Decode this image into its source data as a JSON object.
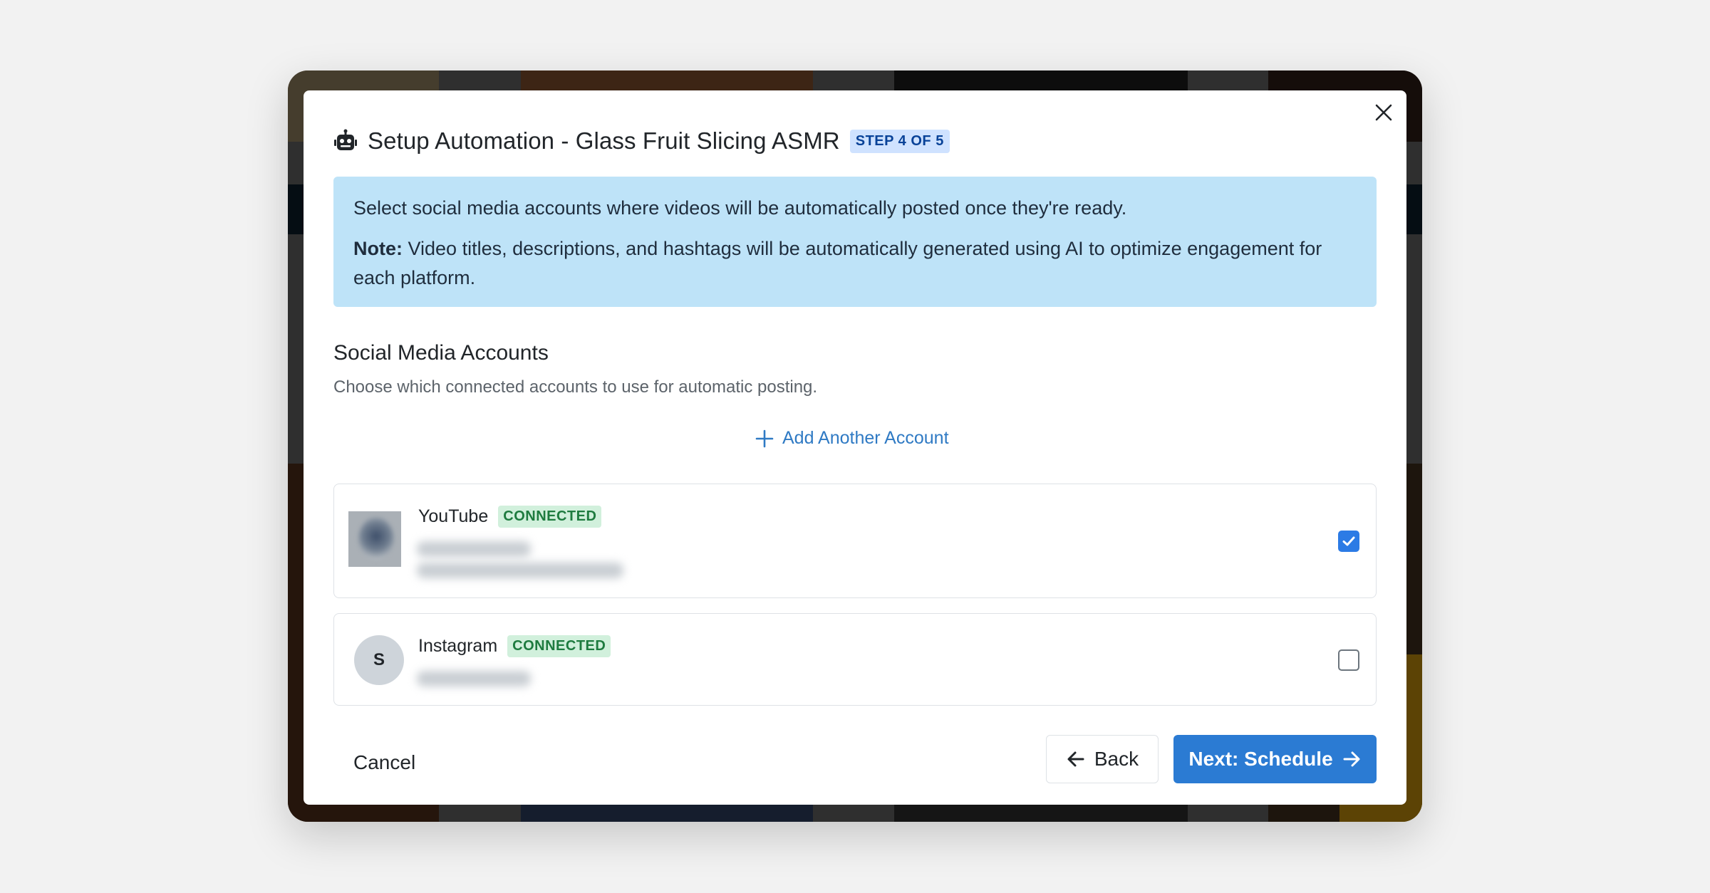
{
  "modal": {
    "title": "Setup Automation - Glass Fruit Slicing ASMR",
    "step_badge": "STEP 4 OF 5",
    "icons": {
      "title": "robot-icon",
      "close": "close-icon"
    }
  },
  "info": {
    "line1": "Select social media accounts where videos will be automatically posted once they're ready.",
    "note_label": "Note:",
    "note_text": " Video titles, descriptions, and hashtags will be automatically generated using AI to optimize engagement for each platform."
  },
  "section": {
    "title": "Social Media Accounts",
    "subtitle": "Choose which connected accounts to use for automatic posting."
  },
  "add_account": {
    "label": "Add Another Account",
    "icon": "plus-icon"
  },
  "accounts": [
    {
      "platform": "YouTube",
      "status": "CONNECTED",
      "selected": true
    },
    {
      "platform": "Instagram",
      "status": "CONNECTED",
      "avatar_letter": "S",
      "selected": false
    }
  ],
  "footer": {
    "cancel": "Cancel",
    "back": "Back",
    "next": "Next: Schedule"
  },
  "colors": {
    "accent": "#2b7bd3",
    "info_bg": "#bee3f8",
    "badge_step_bg": "#cfe2ff",
    "badge_connected_bg": "#d1f0dc"
  }
}
